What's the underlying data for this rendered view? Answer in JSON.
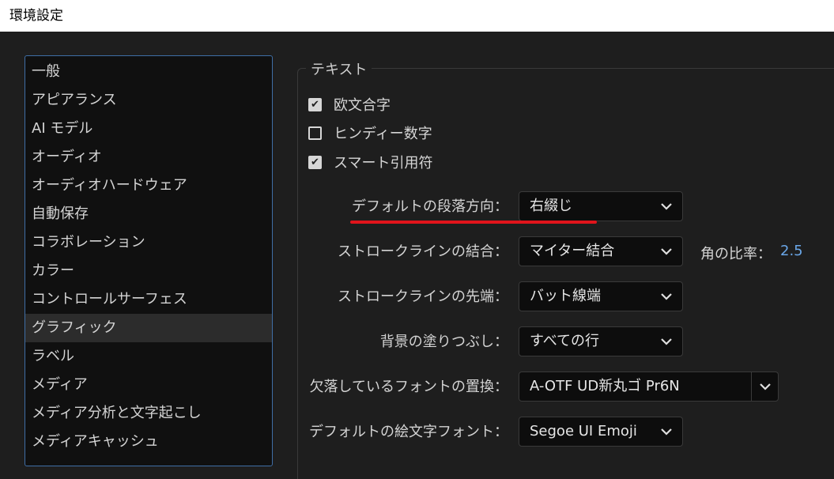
{
  "window": {
    "title": "環境設定"
  },
  "sidebar": {
    "items": [
      {
        "label": "一般"
      },
      {
        "label": "アピアランス"
      },
      {
        "label": "AI モデル"
      },
      {
        "label": "オーディオ"
      },
      {
        "label": "オーディオハードウェア"
      },
      {
        "label": "自動保存"
      },
      {
        "label": "コラボレーション"
      },
      {
        "label": "カラー"
      },
      {
        "label": "コントロールサーフェス"
      },
      {
        "label": "グラフィック"
      },
      {
        "label": "ラベル"
      },
      {
        "label": "メディア"
      },
      {
        "label": "メディア分析と文字起こし"
      },
      {
        "label": "メディアキャッシュ"
      }
    ],
    "selected": "グラフィック"
  },
  "text_section": {
    "title": "テキスト",
    "checkboxes": [
      {
        "label": "欧文合字",
        "checked": true
      },
      {
        "label": "ヒンディー数字",
        "checked": false
      },
      {
        "label": "スマート引用符",
        "checked": true
      }
    ],
    "settings": [
      {
        "label": "デフォルトの段落方向：",
        "value": "右綴じ"
      },
      {
        "label": "ストロークラインの結合：",
        "value": "マイター結合"
      },
      {
        "label": "ストロークラインの先端：",
        "value": "バット線端"
      },
      {
        "label": "背景の塗りつぶし：",
        "value": "すべての行"
      },
      {
        "label": "欠落しているフォントの置換：",
        "value": "A-OTF UD新丸ゴ Pr6N"
      },
      {
        "label": "デフォルトの絵文字フォント：",
        "value": "Segoe UI Emoji"
      }
    ],
    "miter_ratio": {
      "label": "角の比率：",
      "value": "2.5"
    }
  },
  "colors": {
    "background": "#1e1e1e",
    "accent_blue": "#6aa7e8",
    "annotation_red": "#e0141b"
  },
  "icons": {
    "checkbox_checked": "check-icon",
    "dropdown": "chevron-down-icon"
  }
}
